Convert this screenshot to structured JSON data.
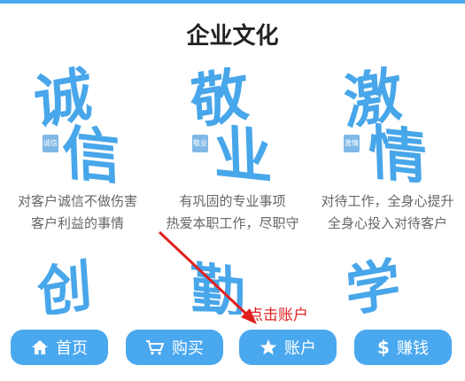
{
  "page": {
    "title": "企业文化"
  },
  "cards": [
    {
      "art": [
        "诚",
        "信"
      ],
      "seal": "诚信",
      "lines": [
        "对客户诚信不做伤害",
        "客户利益的事情"
      ]
    },
    {
      "art": [
        "敬",
        "业"
      ],
      "seal": "敬业",
      "lines": [
        "有巩固的专业事项",
        "热爱本职工作，尽职守"
      ]
    },
    {
      "art": [
        "激",
        "情"
      ],
      "seal": "激情",
      "lines": [
        "对待工作，全身心提升",
        "全身心投入对待客户"
      ]
    }
  ],
  "cards_row2": [
    {
      "art": [
        "创"
      ]
    },
    {
      "art": [
        "勤"
      ]
    },
    {
      "art": [
        "学"
      ]
    }
  ],
  "nav": [
    {
      "label": "首页",
      "icon": "home-icon"
    },
    {
      "label": "购买",
      "icon": "cart-icon"
    },
    {
      "label": "账户",
      "icon": "star-icon"
    },
    {
      "label": "赚钱",
      "icon": "dollar-icon"
    }
  ],
  "annotation": {
    "text": "点击账户",
    "color": "#e02020"
  },
  "colors": {
    "accent": "#4aa8ef",
    "art": "#48a6ea"
  }
}
